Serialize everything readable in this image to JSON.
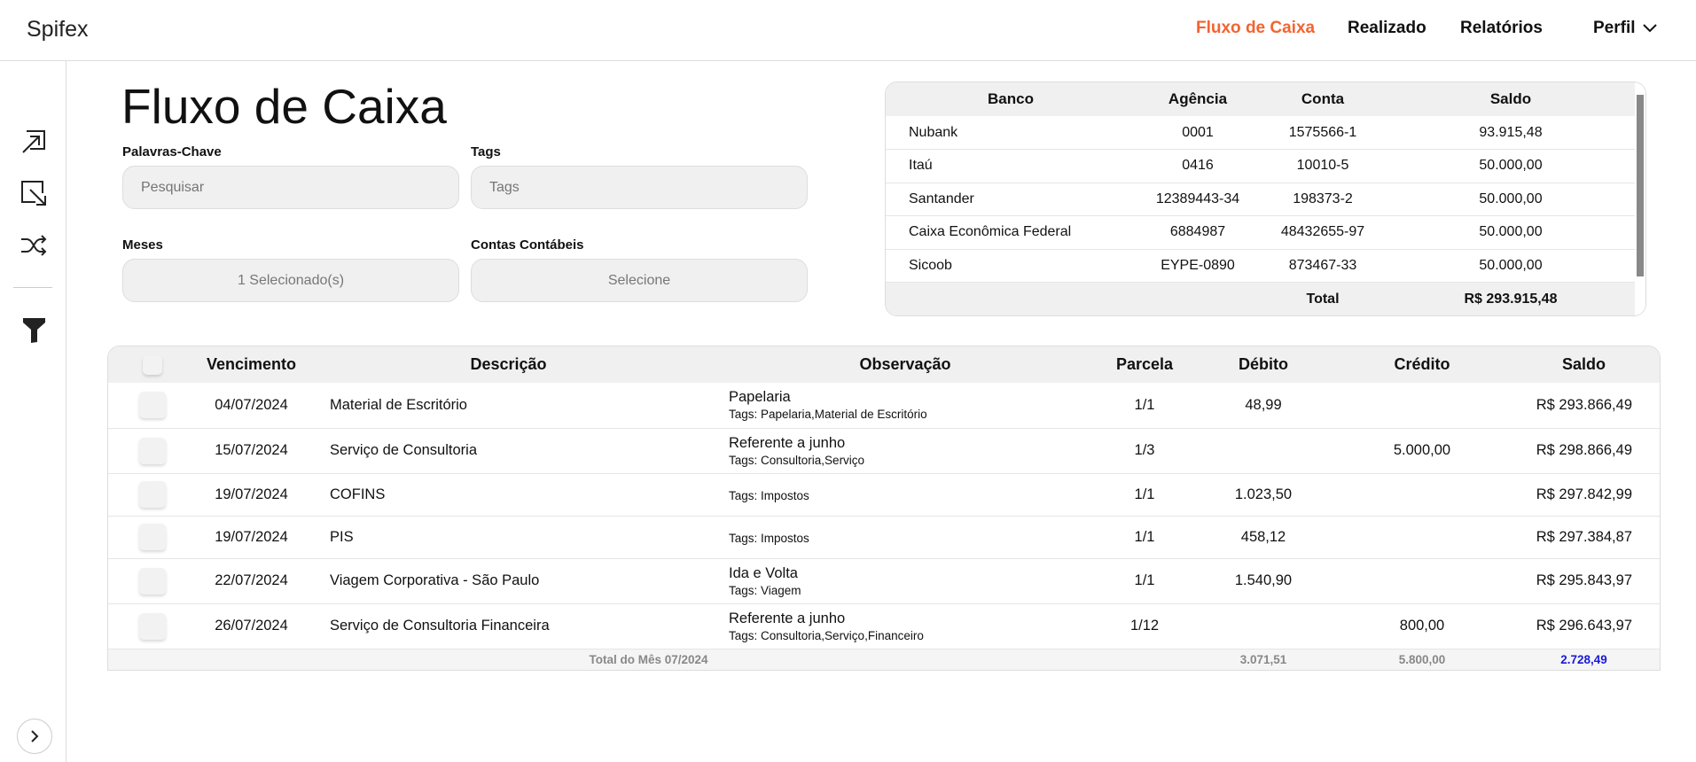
{
  "app": {
    "logo": "Spifex"
  },
  "nav": {
    "items": [
      "Fluxo de Caixa",
      "Realizado",
      "Relatórios",
      "Perfil"
    ],
    "active": "Fluxo de Caixa",
    "accent": "#f26430"
  },
  "sidebar": {
    "icons": [
      "arrow-up-right-box-icon",
      "arrow-down-right-box-icon",
      "shuffle-icon",
      "filter-icon",
      "chevron-right-icon"
    ]
  },
  "page": {
    "title": "Fluxo de Caixa"
  },
  "filters": {
    "keywords": {
      "label": "Palavras-Chave",
      "placeholder": "Pesquisar"
    },
    "tags": {
      "label": "Tags",
      "placeholder": "Tags"
    },
    "months": {
      "label": "Meses",
      "value": "1 Selecionado(s)"
    },
    "accounts": {
      "label": "Contas Contábeis",
      "value": "Selecione"
    }
  },
  "banks": {
    "headers": [
      "Banco",
      "Agência",
      "Conta",
      "Saldo"
    ],
    "rows": [
      [
        "Nubank",
        "0001",
        "1575566-1",
        "93.915,48"
      ],
      [
        "Itaú",
        "0416",
        "10010-5",
        "50.000,00"
      ],
      [
        "Santander",
        "12389443-34",
        "198373-2",
        "50.000,00"
      ],
      [
        "Caixa Econômica Federal",
        "6884987",
        "48432655-97",
        "50.000,00"
      ],
      [
        "Sicoob",
        "EYPE-0890",
        "873467-33",
        "50.000,00"
      ]
    ],
    "total_label": "Total",
    "total_value": "R$ 293.915,48"
  },
  "entries": {
    "headers": [
      "Vencimento",
      "Descrição",
      "Observação",
      "Parcela",
      "Débito",
      "Crédito",
      "Saldo"
    ],
    "rows": [
      {
        "date": "04/07/2024",
        "desc": "Material de Escritório",
        "obs": "Papelaria",
        "tags": "Tags: Papelaria,Material de Escritório",
        "parcela": "1/1",
        "debito": "48,99",
        "credito": "",
        "saldo": "R$ 293.866,49"
      },
      {
        "date": "15/07/2024",
        "desc": "Serviço de Consultoria",
        "obs": "Referente a junho",
        "tags": "Tags: Consultoria,Serviço",
        "parcela": "1/3",
        "debito": "",
        "credito": "5.000,00",
        "saldo": "R$ 298.866,49"
      },
      {
        "date": "19/07/2024",
        "desc": "COFINS",
        "obs": "",
        "tags": "Tags: Impostos",
        "parcela": "1/1",
        "debito": "1.023,50",
        "credito": "",
        "saldo": "R$ 297.842,99"
      },
      {
        "date": "19/07/2024",
        "desc": "PIS",
        "obs": "",
        "tags": "Tags: Impostos",
        "parcela": "1/1",
        "debito": "458,12",
        "credito": "",
        "saldo": "R$ 297.384,87"
      },
      {
        "date": "22/07/2024",
        "desc": "Viagem Corporativa - São Paulo",
        "obs": "Ida e Volta",
        "tags": "Tags: Viagem",
        "parcela": "1/1",
        "debito": "1.540,90",
        "credito": "",
        "saldo": "R$ 295.843,97"
      },
      {
        "date": "26/07/2024",
        "desc": "Serviço de Consultoria Financeira",
        "obs": "Referente a junho",
        "tags": "Tags: Consultoria,Serviço,Financeiro",
        "parcela": "1/12",
        "debito": "",
        "credito": "800,00",
        "saldo": "R$ 296.643,97"
      }
    ],
    "total": {
      "label": "Total do Mês 07/2024",
      "debito": "3.071,51",
      "credito": "5.800,00",
      "saldo": "2.728,49",
      "saldo_color": "#1a1adb"
    }
  }
}
